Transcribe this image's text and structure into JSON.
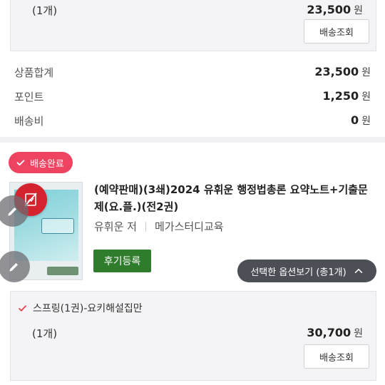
{
  "top_option": {
    "quantity": "(1개)",
    "price": "23,500",
    "unit": "원",
    "ship_button": "배송조회"
  },
  "summary": [
    {
      "label": "상품합계",
      "value": "23,500",
      "unit": "원"
    },
    {
      "label": "포인트",
      "value": "1,250",
      "unit": "원"
    },
    {
      "label": "배송비",
      "value": "0",
      "unit": "원"
    }
  ],
  "order": {
    "status_badge": "배송완료",
    "product_title": "(예약판매)(3쇄)2024 유휘운 행정법총론 요약노트+기출문제(요.플.)(전2권)",
    "author": "유휘운 저",
    "publisher": "메가스터디교육",
    "review_button": "후기등록",
    "option_toggle": "선택한 옵션보기 (총1개)",
    "option": {
      "name": "스프링(1권)-요키해설집만",
      "quantity": "(1개)",
      "price": "30,700",
      "unit": "원",
      "ship_button": "배송조회"
    }
  },
  "colors": {
    "badge": "#ef4461",
    "review_button": "#2f7d2c",
    "option_toggle": "#4d4f57",
    "option_box": "#f4f4f6"
  },
  "icons": {
    "badge": "check-icon",
    "option_toggle": "chevron-up-icon",
    "option_name": "check-icon",
    "edit_fab": "pencil-icon",
    "no_image_fab": "no-image-icon"
  }
}
